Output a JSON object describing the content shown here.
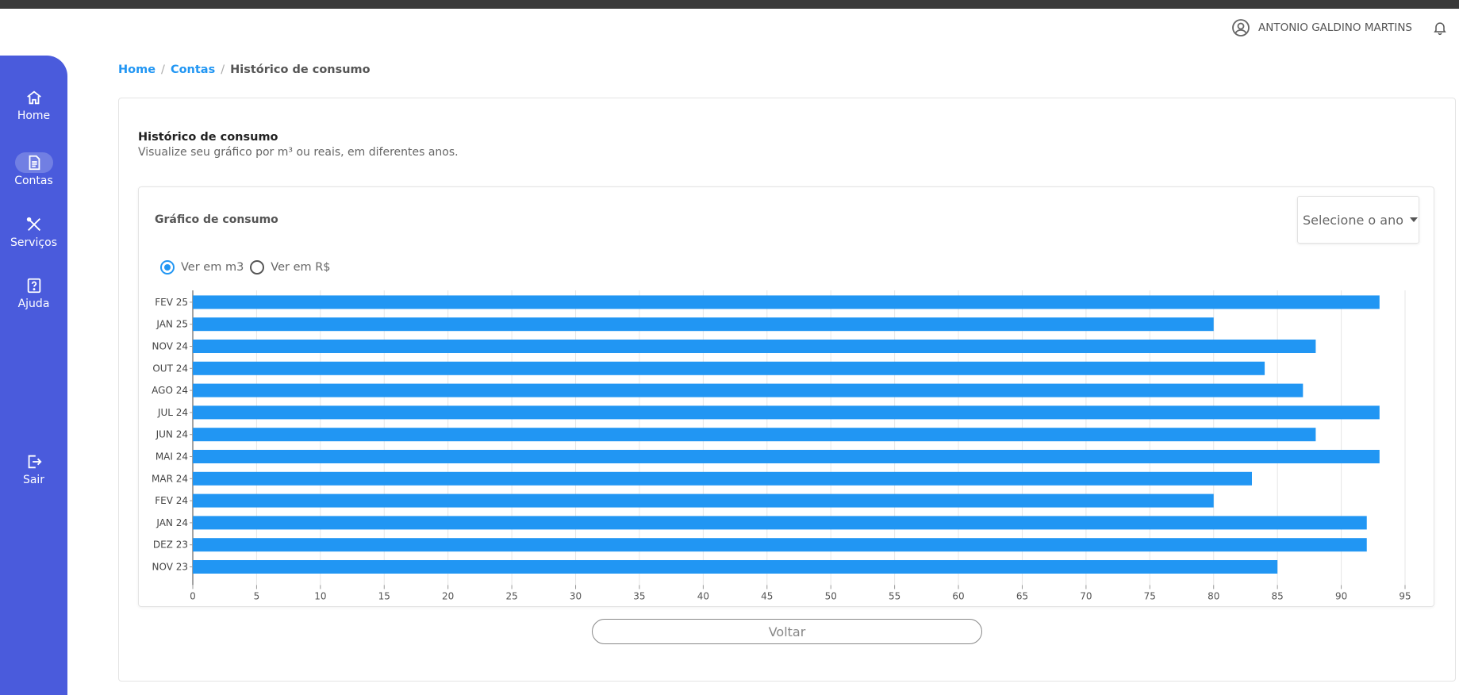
{
  "header": {
    "user_name": "ANTONIO GALDINO MARTINS"
  },
  "sidebar": {
    "items": [
      {
        "label": "Home",
        "icon": "home-icon"
      },
      {
        "label": "Contas",
        "icon": "document-icon"
      },
      {
        "label": "Serviços",
        "icon": "tools-icon"
      },
      {
        "label": "Ajuda",
        "icon": "help-icon"
      },
      {
        "label": "Sair",
        "icon": "logout-icon"
      }
    ],
    "active": "Contas"
  },
  "breadcrumb": {
    "home": "Home",
    "sep": "/",
    "contas": "Contas",
    "current": "Histórico de consumo"
  },
  "page": {
    "title": "Histórico de consumo",
    "subtitle": "Visualize seu gráfico por m³ ou reais, em diferentes anos."
  },
  "chart_card": {
    "title": "Gráfico de consumo",
    "year_select_placeholder": "Selecione o ano",
    "radio_m3": "Ver em m3",
    "radio_rs": "Ver em R$",
    "selected": "m3"
  },
  "actions": {
    "back_label": "Voltar"
  },
  "colors": {
    "sidebar": "#4a5bdc",
    "bar": "#2196f3",
    "link": "#2196f3"
  },
  "chart_data": {
    "type": "bar",
    "orientation": "horizontal",
    "categories": [
      "FEV 25",
      "JAN 25",
      "NOV 24",
      "OUT 24",
      "AGO 24",
      "JUL 24",
      "JUN 24",
      "MAI 24",
      "MAR 24",
      "FEV 24",
      "JAN 24",
      "DEZ 23",
      "NOV 23"
    ],
    "values": [
      93,
      80,
      88,
      84,
      87,
      93,
      88,
      93,
      83,
      80,
      92,
      92,
      85
    ],
    "xlim": [
      0,
      95
    ],
    "xticks": [
      0,
      5,
      10,
      15,
      20,
      25,
      30,
      35,
      40,
      45,
      50,
      55,
      60,
      65,
      70,
      75,
      80,
      85,
      90,
      95
    ],
    "grid": "vertical",
    "title": "",
    "xlabel": "",
    "ylabel": ""
  }
}
